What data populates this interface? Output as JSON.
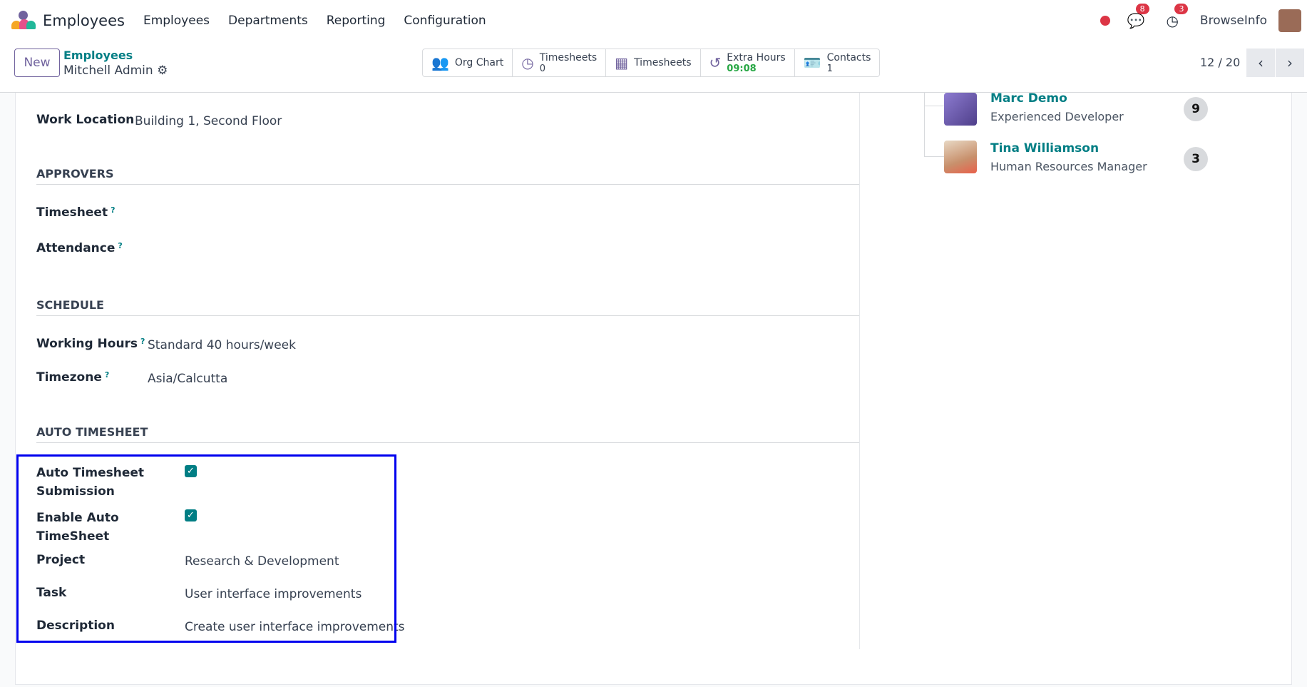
{
  "nav": {
    "app": "Employees",
    "menus": [
      "Employees",
      "Departments",
      "Reporting",
      "Configuration"
    ],
    "messages_count": "8",
    "activities_count": "3",
    "user": "BrowseInfo"
  },
  "control": {
    "new_label": "New",
    "breadcrumb_parent": "Employees",
    "breadcrumb_current": "Mitchell Admin",
    "pager": "12 / 20",
    "smart_buttons": [
      {
        "label": "Org Chart",
        "icon": "org-chart-icon"
      },
      {
        "label": "Timesheets",
        "value": "0",
        "icon": "clock-icon"
      },
      {
        "label": "Timesheets",
        "icon": "calendar-icon"
      },
      {
        "label": "Extra Hours",
        "value": "09:08",
        "icon": "history-icon"
      },
      {
        "label": "Contacts",
        "value": "1",
        "icon": "id-card-icon"
      }
    ]
  },
  "form": {
    "work_location_label": "Work Location",
    "work_location": "Building 1, Second Floor",
    "approvers_title": "APPROVERS",
    "timesheet_label": "Timesheet",
    "attendance_label": "Attendance",
    "schedule_title": "SCHEDULE",
    "working_hours_label": "Working Hours",
    "working_hours": "Standard 40 hours/week",
    "timezone_label": "Timezone",
    "timezone": "Asia/Calcutta",
    "auto_title": "AUTO TIMESHEET",
    "auto_submit_label_1": "Auto Timesheet",
    "auto_submit_label_2": "Submission",
    "enable_label_1": "Enable Auto",
    "enable_label_2": "TimeSheet",
    "project_label": "Project",
    "project": "Research & Development",
    "task_label": "Task",
    "task": "User interface improvements",
    "description_label": "Description",
    "description": "Create user interface improvements",
    "q": "?"
  },
  "org": [
    {
      "name": "Marc Demo",
      "title": "Experienced Developer",
      "count": "9"
    },
    {
      "name": "Tina Williamson",
      "title": "Human Resources Manager",
      "count": "3"
    }
  ]
}
